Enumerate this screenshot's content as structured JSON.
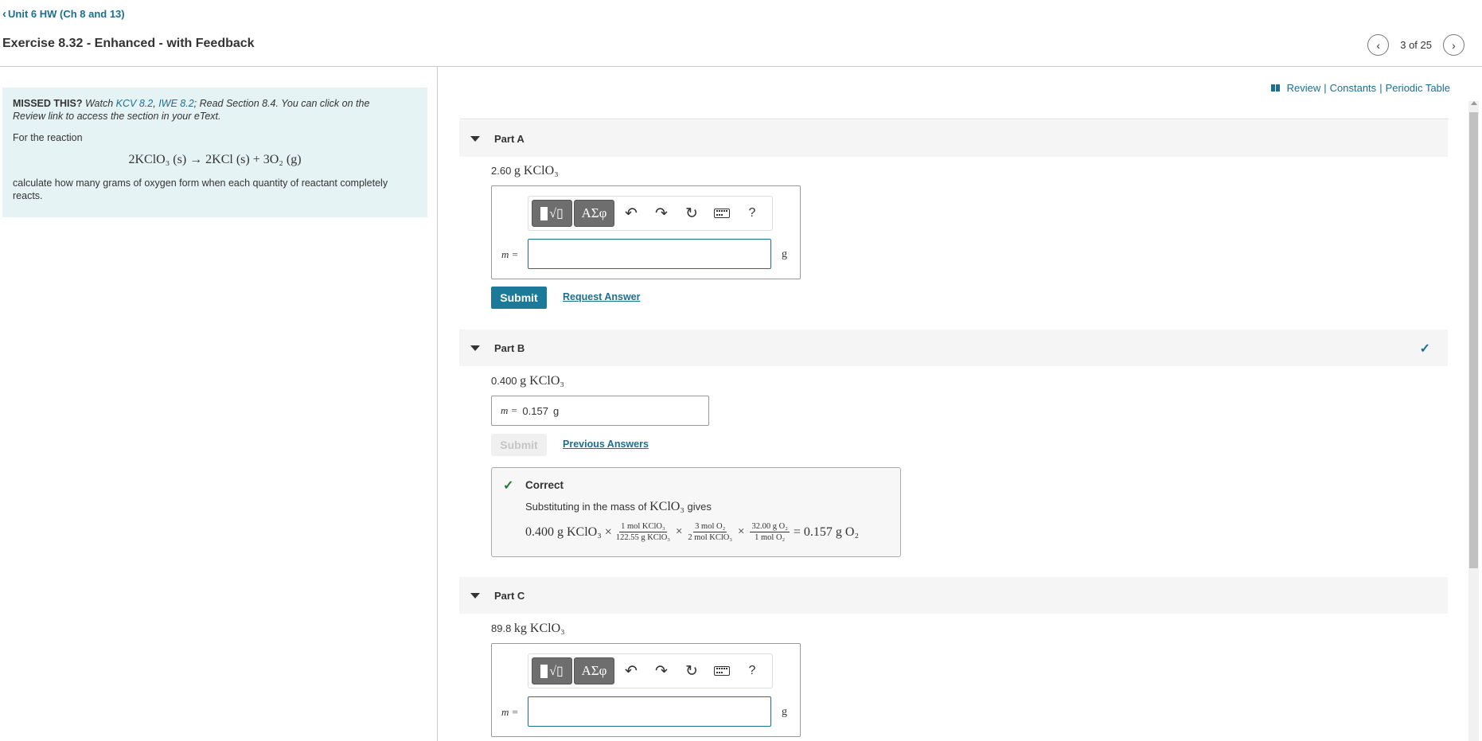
{
  "header": {
    "back_link": "Unit 6 HW (Ch 8 and 13)",
    "title": "Exercise 8.32 - Enhanced - with Feedback",
    "page_counter": "3 of 25"
  },
  "top_links": {
    "review": "Review",
    "separator": "|",
    "constants": "Constants",
    "periodic_table": "Periodic Table"
  },
  "intro": {
    "missed_label": "MISSED THIS?",
    "watch_text": " Watch ",
    "kcv_link": "KCV 8.2",
    "comma": ", ",
    "iwe_link": "IWE 8.2",
    "rest_line1": "; Read Section 8.4. You can click on the",
    "rest_line2": "Review link to access the section in your eText.",
    "for_reaction": "For the reaction",
    "equation": "2KClO₃ (s) → 2KCl (s) + 3O₂ (g)",
    "instruction": "calculate how many grams of oxygen form when each quantity of reactant completely reacts."
  },
  "toolbar": {
    "templates_glyph": "√▯",
    "greek_label": "AΣφ",
    "undo_icon": "↶",
    "redo_icon": "↷",
    "reset_icon": "↻",
    "help_label": "?"
  },
  "parts": [
    {
      "label": "Part A",
      "prompt_num": "2.60 ",
      "prompt_chem": "g KClO₃",
      "var_label": "m =",
      "input_value": "",
      "unit": "g",
      "submit": "Submit",
      "secondary_link": "Request Answer"
    },
    {
      "label": "Part B",
      "prompt_num": "0.400 ",
      "prompt_chem": "g KClO₃",
      "var_label": "m =",
      "answer_value": "0.157",
      "unit": "g",
      "submit": "Submit",
      "secondary_link": "Previous Answers",
      "status": "correct",
      "feedback": {
        "title": "Correct",
        "sub_text": "Substituting in the mass of ",
        "sub_chem": "KClO₃",
        "sub_tail": " gives",
        "eq_start": "0.400 g KClO₃ ×",
        "f1_num": "1 mol KClO₃",
        "f1_den": "122.55 g KClO₃",
        "times": "×",
        "f2_num": "3 mol O₂",
        "f2_den": "2 mol KClO₃",
        "f3_num": "32.00 g O₂",
        "f3_den": "1 mol O₂",
        "result": "= 0.157 g O₂"
      }
    },
    {
      "label": "Part C",
      "prompt_num": "89.8 ",
      "prompt_chem": "kg KClO₃",
      "var_label": "m =",
      "input_value": "",
      "unit": "g"
    }
  ],
  "colors": {
    "accent": "#1b6f91",
    "submit_bg": "#1b7a9a",
    "intro_bg": "#e6f3f5",
    "correct_green": "#1a7f2e"
  },
  "icons": [
    "chevron-left-icon",
    "chevron-right-icon",
    "book-icon",
    "caret-down-icon",
    "check-icon",
    "undo-icon",
    "redo-icon",
    "reset-icon",
    "keyboard-icon",
    "help-icon"
  ]
}
